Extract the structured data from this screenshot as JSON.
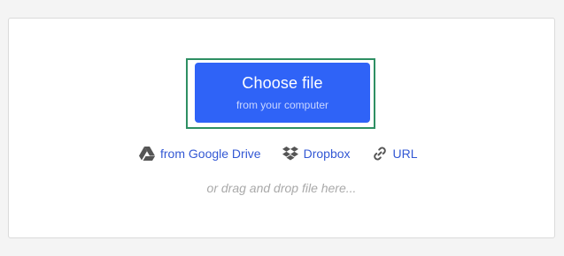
{
  "upload": {
    "choose_file_label": "Choose file",
    "choose_file_sub": "from your computer",
    "sources": [
      {
        "label": "from Google Drive",
        "icon": "google-drive-icon"
      },
      {
        "label": "Dropbox",
        "icon": "dropbox-icon"
      },
      {
        "label": "URL",
        "icon": "link-icon"
      }
    ],
    "drag_drop_hint": "or drag and drop file here..."
  },
  "colors": {
    "button_bg": "#2f63f7",
    "focus_ring": "#2e8f63",
    "link": "#3358d4",
    "hint": "#a9a9a9",
    "icon": "#555555"
  }
}
